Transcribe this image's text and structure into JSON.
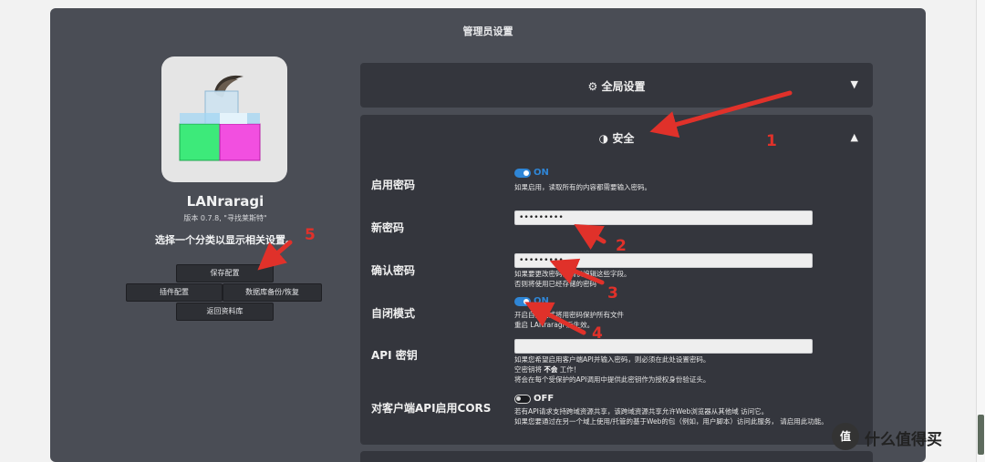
{
  "page": {
    "title": "管理员设置"
  },
  "app": {
    "name": "LANraragi",
    "version": "版本 0.7.8, \"寻找莱斯特\"",
    "hint": "选择一个分类以显示相关设置。"
  },
  "buttons": {
    "save": "保存配置",
    "plugins": "插件配置",
    "backup": "数据库备份/恢复",
    "back": "返回资料库"
  },
  "sections": {
    "global": {
      "icon": "cogs-icon",
      "title": "全局设置",
      "chevron": "▼"
    },
    "security": {
      "icon": "shield-icon",
      "title": "安全",
      "chevron": "▲"
    }
  },
  "security": {
    "enable_password": {
      "label": "启用密码",
      "toggle": "ON",
      "desc": "如果启用，读取所有的内容都需要输入密码。"
    },
    "new_password": {
      "label": "新密码",
      "value": "•••••••••"
    },
    "confirm_password": {
      "label": "确认密码",
      "value": "•••••••••",
      "desc1": "如果要更改密码，请仅编辑这些字段。",
      "desc2": "否则将使用已经存储的密码"
    },
    "nofun_mode": {
      "label": "自闭模式",
      "toggle": "ON",
      "desc1": "开启自闭模式将用密码保护所有文件",
      "desc2": "重启 LANraragi 后生效。"
    },
    "api_key": {
      "label": "API 密钥",
      "value": "",
      "desc1": "如果您希望启用客户端API并输入密码，则必须在此处设置密码。",
      "desc2_pre": "空密钥将",
      "desc2_bold": "不会",
      "desc2_post": "工作！",
      "desc3": "将会在每个受保护的API调用中提供此密钥作为授权身份验证头。"
    },
    "cors": {
      "label": "对客户端API启用CORS",
      "toggle": "OFF",
      "desc1": "若有API请求支持跨域资源共享，该跨域资源共享允许Web浏览器从其他域 访问它。",
      "desc2": "如果您要通过在另一个域上使用/托管的基于Web的包（例如，用户脚本）访问此服务， 请启用此功能。"
    }
  },
  "annotations": [
    "1",
    "2",
    "3",
    "4",
    "5"
  ],
  "watermark": {
    "badge": "值",
    "text": "什么值得买"
  },
  "colors": {
    "accent": "#2f86d6",
    "panel": "#4a4d55",
    "section": "#34363d",
    "arrow": "#e0312a"
  }
}
